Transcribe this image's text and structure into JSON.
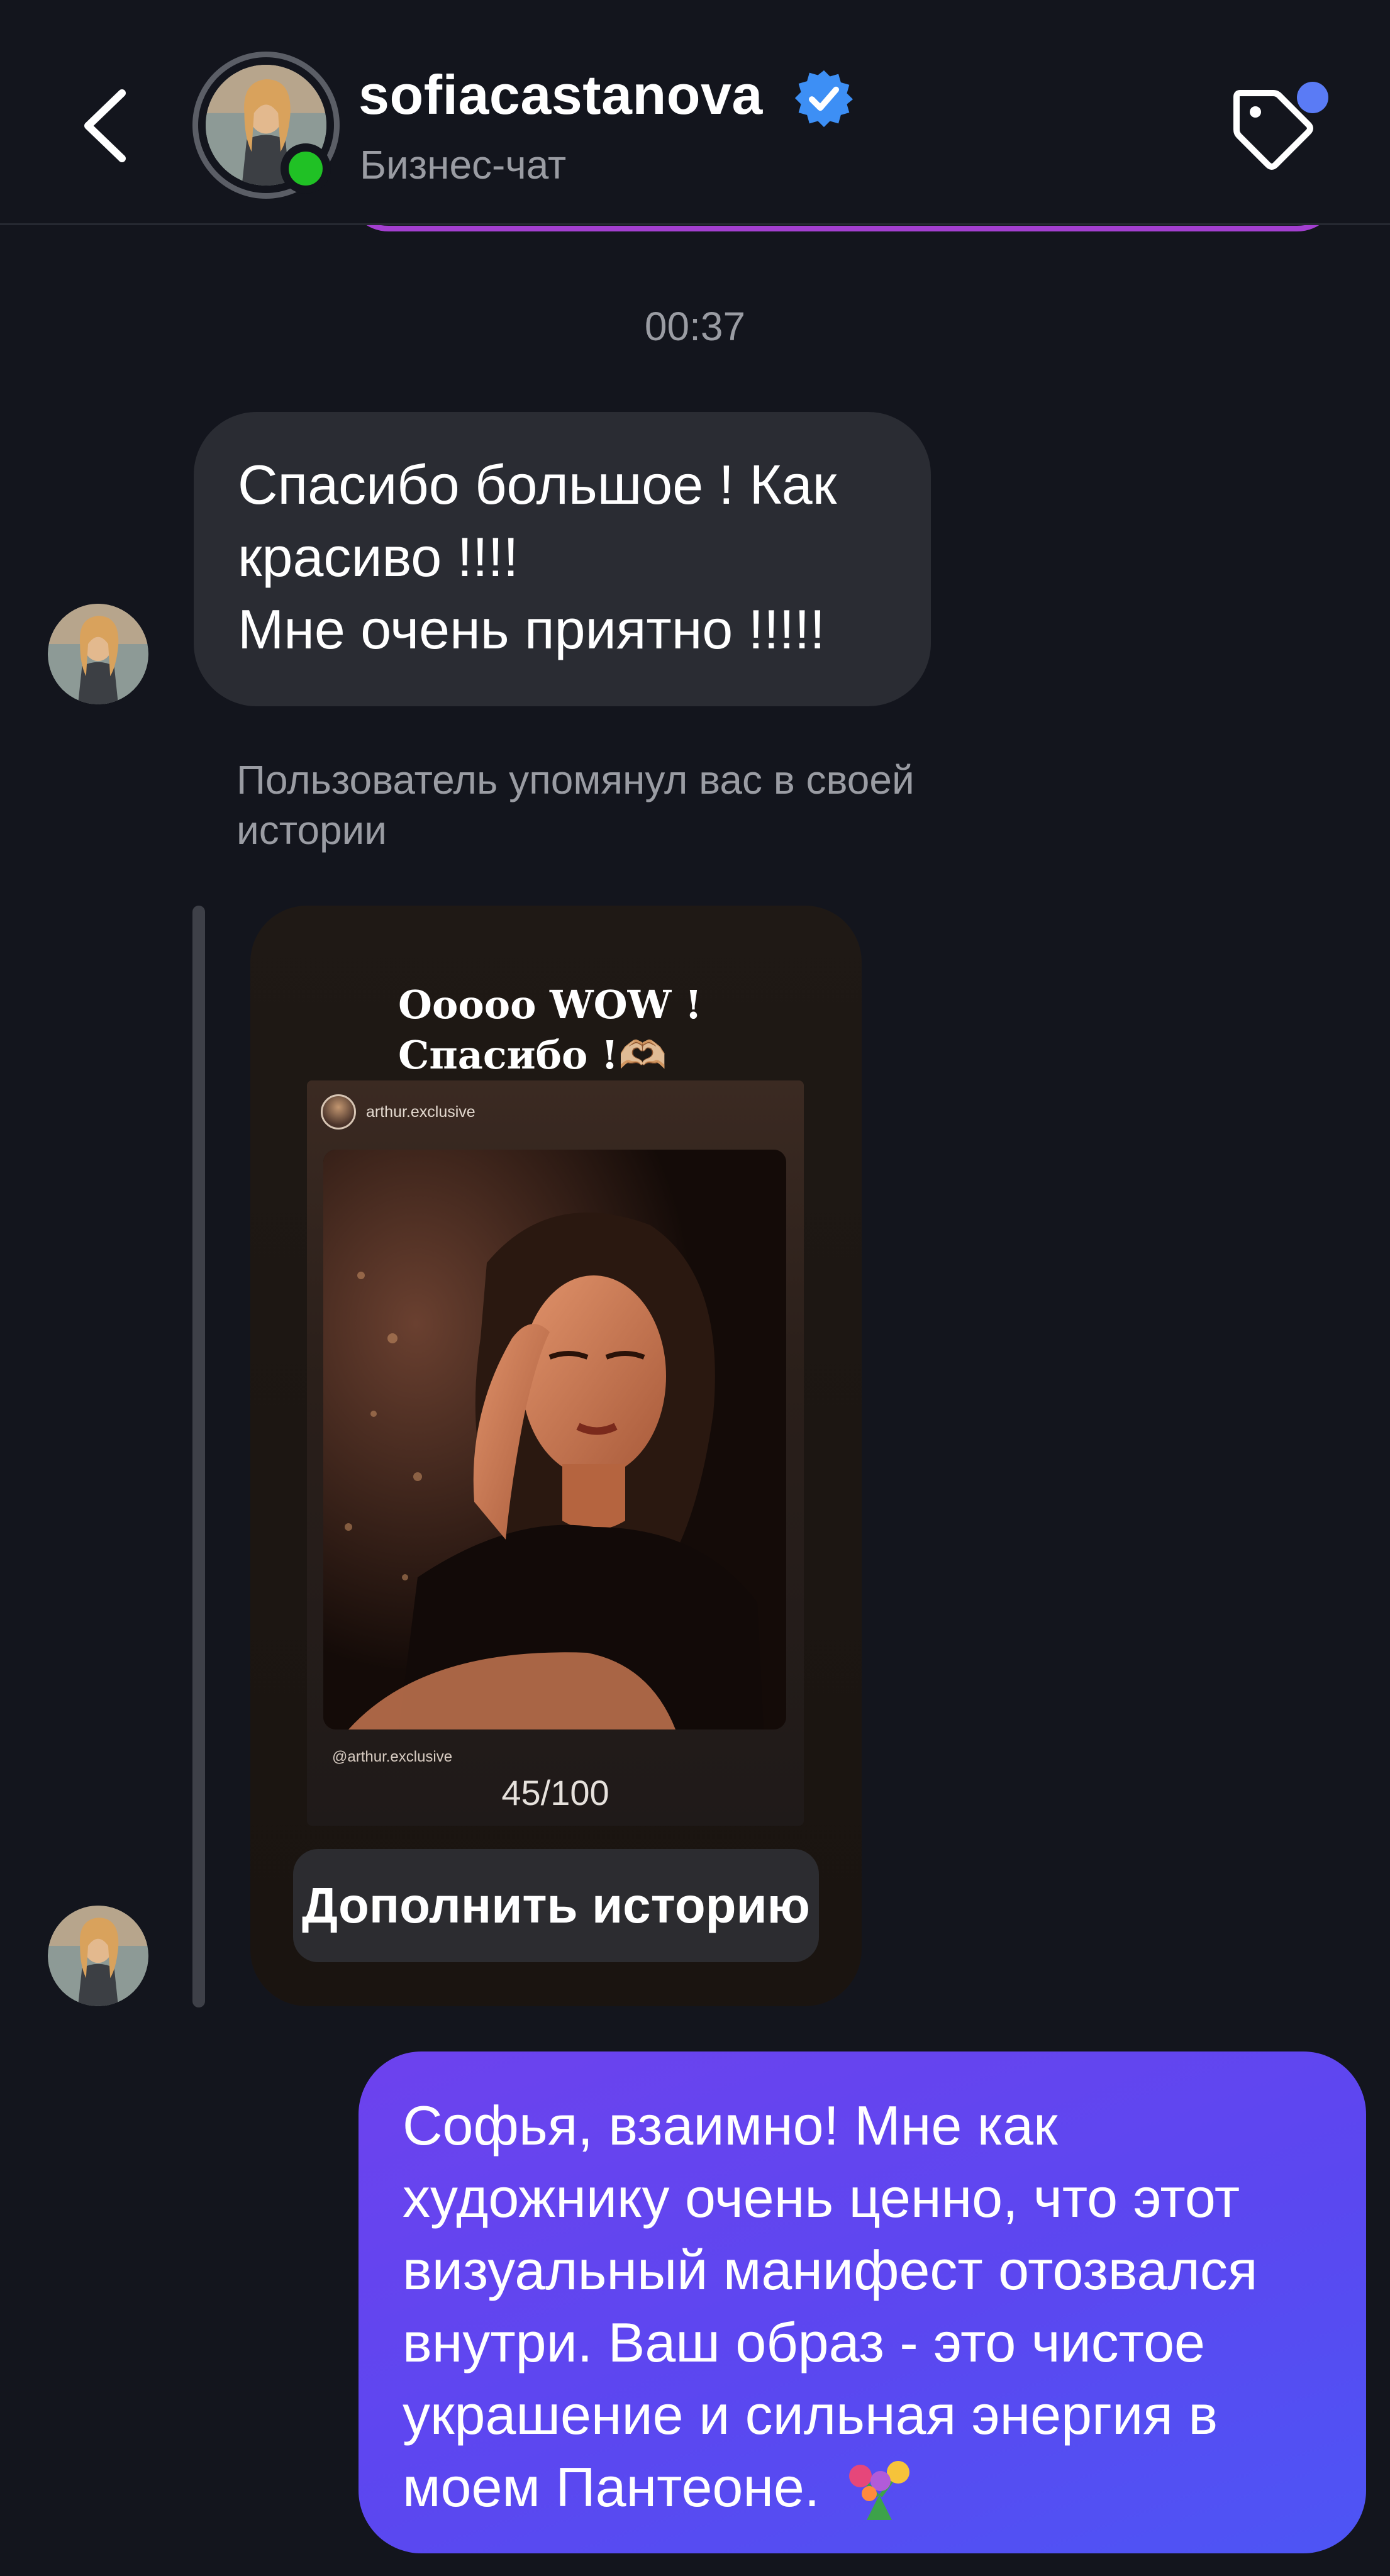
{
  "header": {
    "username": "sofiacastanova",
    "subtitle": "Бизнес-чат"
  },
  "conversation": {
    "timestamp": "00:37",
    "incoming_message": {
      "lines": [
        "Спасибо большое ! Как",
        "красиво !!!!",
        "Мне очень приятно !!!!!"
      ]
    },
    "mention_note": "Пользователь упомянул вас в своей истории",
    "story": {
      "title_lines": [
        "Ooooo WOW !",
        "Спасибо !🫶🏼"
      ],
      "repost_handle": "arthur.exclusive",
      "repost_caption": "@arthur.exclusive",
      "counter": "45/100",
      "add_button_label": "Дополнить историю"
    },
    "outgoing_message": {
      "lines": [
        "Софья, взаимно! Мне как",
        "художнику очень ценно, что этот",
        "визуальный манифест отозвался",
        "внутри. Ваш образ - это чистое",
        "украшение и сильная энергия в",
        "моем Пантеоне."
      ],
      "emoji": "flowers-bouquet-icon"
    }
  },
  "colors": {
    "background": "#13151d",
    "incoming_bubble": "#2a2c33",
    "outgoing_bubble_start": "#6d42ee",
    "outgoing_bubble_end": "#4d55f5",
    "verified": "#3d8ff5",
    "online": "#20c125",
    "notification": "#5a7bf5"
  }
}
